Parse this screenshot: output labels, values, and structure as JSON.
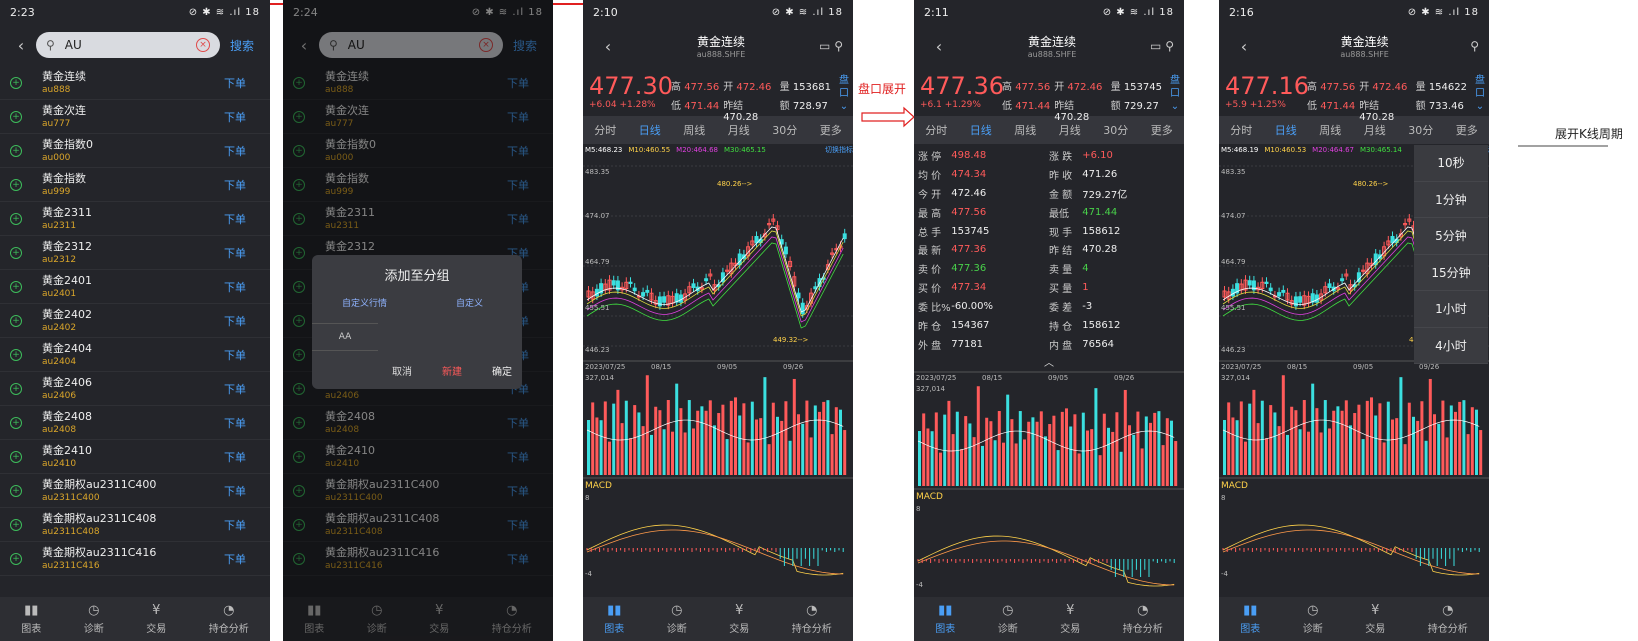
{
  "screens": {
    "s1": {
      "time": "2:23",
      "query": "AU",
      "search_label": "搜索"
    },
    "s2": {
      "time": "2:24",
      "query": "AU",
      "search_label": "搜索"
    },
    "s3": {
      "time": "2:10"
    },
    "s4": {
      "time": "2:11"
    },
    "s5": {
      "time": "2:16"
    }
  },
  "status_icons": "⊘ ✱ ≋ .ıl 18",
  "list": [
    {
      "name": "黄金连续",
      "code": "au888"
    },
    {
      "name": "黄金次连",
      "code": "au777"
    },
    {
      "name": "黄金指数0",
      "code": "au000"
    },
    {
      "name": "黄金指数",
      "code": "au999"
    },
    {
      "name": "黄金2311",
      "code": "au2311"
    },
    {
      "name": "黄金2312",
      "code": "au2312"
    },
    {
      "name": "黄金2401",
      "code": "au2401"
    },
    {
      "name": "黄金2402",
      "code": "au2402"
    },
    {
      "name": "黄金2404",
      "code": "au2404"
    },
    {
      "name": "黄金2406",
      "code": "au2406"
    },
    {
      "name": "黄金2408",
      "code": "au2408"
    },
    {
      "name": "黄金2410",
      "code": "au2410"
    },
    {
      "name": "黄金期权au2311C400",
      "code": "au2311C400"
    },
    {
      "name": "黄金期权au2311C408",
      "code": "au2311C408"
    },
    {
      "name": "黄金期权au2311C416",
      "code": "au2311C416"
    }
  ],
  "order_label": "下单",
  "tabs": [
    "图表",
    "诊断",
    "交易",
    "持仓分析"
  ],
  "dialog": {
    "title": "添加至分组",
    "col1": "自定义行情",
    "col2": "自定义",
    "group": "AA",
    "cancel": "取消",
    "new": "新建",
    "ok": "确定"
  },
  "header": {
    "title": "黄金连续",
    "code": "au888.SHFE"
  },
  "side_labels": [
    "盘",
    "口"
  ],
  "periods": [
    "分时",
    "日线",
    "周线",
    "月线",
    "30分",
    "更多"
  ],
  "quotes": {
    "s3": {
      "price": "477.30",
      "change": "+6.04",
      "pct": "+1.28%",
      "high": "477.56",
      "open": "472.46",
      "vol": "153681",
      "low": "471.44",
      "prev": "470.28",
      "amt": "728.97"
    },
    "s4": {
      "price": "477.36",
      "change": "+6.1",
      "pct": "+1.29%",
      "high": "477.56",
      "open": "472.46",
      "vol": "153745",
      "low": "471.44",
      "prev": "470.28",
      "amt": "729.27"
    },
    "s5": {
      "price": "477.16",
      "change": "+5.9",
      "pct": "+1.25%",
      "high": "477.56",
      "open": "472.46",
      "vol": "154622",
      "low": "471.44",
      "prev": "470.28",
      "amt": "733.46"
    }
  },
  "quote_labels": {
    "high": "高",
    "open": "开",
    "vol": "量",
    "low": "低",
    "prev": "昨结",
    "amt": "额"
  },
  "ma": {
    "s3": [
      "M5:468.23",
      "M10:460.55",
      "M20:464.68",
      "M30:465.15"
    ],
    "s5": [
      "M5:468.19",
      "M10:460.53",
      "M20:464.67",
      "M30:465.14"
    ]
  },
  "switch_label": "切换指标",
  "chart_text": {
    "ytop": "483.35",
    "y2": "474.07",
    "y3": "464.79",
    "y4": "455.51",
    "ybot": "446.23",
    "hi": "480.26",
    "lo": "449.32",
    "dates": [
      "2023/07/25",
      "08/15",
      "09/05",
      "09/26"
    ],
    "volmax": "327,014",
    "macd": "MACD",
    "m8": "8",
    "mm4": "-4"
  },
  "details": [
    [
      "涨 停",
      "498.48",
      "red",
      "涨 跌",
      "+6.10",
      "red"
    ],
    [
      "均 价",
      "474.34",
      "red",
      "昨 收",
      "471.26",
      "wht"
    ],
    [
      "今 开",
      "472.46",
      "wht",
      "金 额",
      "729.27亿",
      "wht"
    ],
    [
      "最 高",
      "477.56",
      "red",
      "最低",
      "471.44",
      "grn"
    ],
    [
      "总 手",
      "153745",
      "wht",
      "现 手",
      "158612",
      "wht"
    ],
    [
      "最 新",
      "477.36",
      "red",
      "昨 结",
      "470.28",
      "wht"
    ],
    [
      "卖 价",
      "477.36",
      "grn",
      "卖 量",
      "4",
      "grn"
    ],
    [
      "买 价",
      "477.34",
      "red",
      "买 量",
      "1",
      "red"
    ],
    [
      "委 比%",
      "-60.00%",
      "wht",
      "委 差",
      "-3",
      "wht"
    ],
    [
      "昨 仓",
      "154367",
      "wht",
      "持 仓",
      "158612",
      "wht"
    ],
    [
      "外 盘",
      "77181",
      "wht",
      "内 盘",
      "76564",
      "wht"
    ]
  ],
  "dropdown": [
    "10秒",
    "1分钟",
    "5分钟",
    "15分钟",
    "1小时",
    "4小时"
  ],
  "annotations": {
    "a1": "盘口展开",
    "a2": "展开K线周期"
  }
}
